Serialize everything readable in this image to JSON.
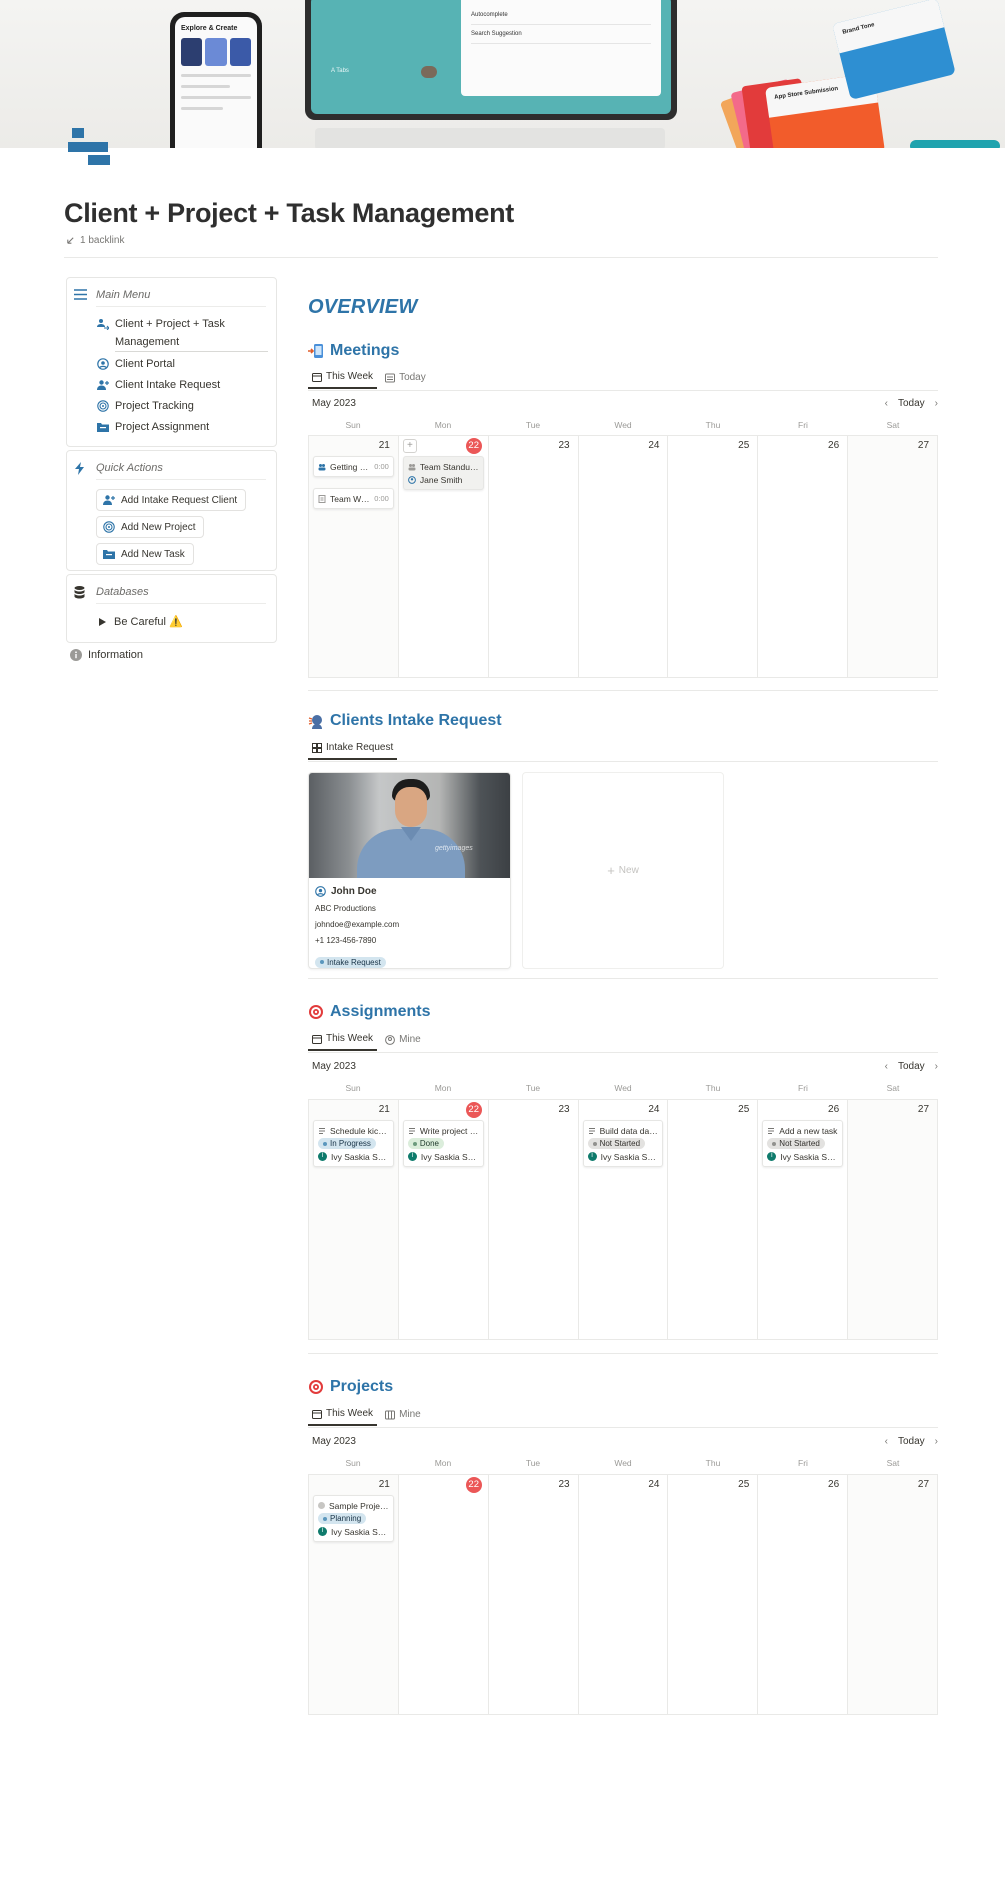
{
  "cover": {
    "phone_title": "Explore & Create",
    "panel_items": [
      "Autocomplete",
      "Search Suggestion"
    ],
    "tablet_label": "A Tabs",
    "card_blue": "Brand Tone",
    "card_orange": "App Store Submission"
  },
  "page": {
    "title": "Client + Project + Task Management",
    "backlink": "1 backlink"
  },
  "sidebar": {
    "main_menu": {
      "heading": "Main Menu",
      "items": [
        {
          "label": "Client + Project + Task Management",
          "icon": "people-arrow-icon"
        },
        {
          "label": "Client Portal",
          "icon": "user-circle-icon"
        },
        {
          "label": "Client Intake Request",
          "icon": "user-plus-icon"
        },
        {
          "label": "Project Tracking",
          "icon": "target-icon"
        },
        {
          "label": "Project Assignment",
          "icon": "folder-icon"
        }
      ]
    },
    "quick_actions": {
      "heading": "Quick Actions",
      "buttons": [
        {
          "label": "Add Intake Request Client",
          "icon": "user-plus-icon"
        },
        {
          "label": "Add New Project",
          "icon": "target-icon"
        },
        {
          "label": "Add New Task",
          "icon": "folder-icon"
        }
      ]
    },
    "databases": {
      "heading": "Databases",
      "toggle_label": "Be Careful ⚠️"
    },
    "information": "Information"
  },
  "main": {
    "overview": "OVERVIEW",
    "days_of_week": [
      "Sun",
      "Mon",
      "Tue",
      "Wed",
      "Thu",
      "Fri",
      "Sat"
    ],
    "dates": [
      "21",
      "22",
      "23",
      "24",
      "25",
      "26",
      "27"
    ],
    "month": "May 2023",
    "today_label": "Today",
    "meetings": {
      "title": "Meetings",
      "tabs": [
        "This Week",
        "Today"
      ],
      "events": [
        {
          "title": "Getting star…",
          "time": "0:00"
        },
        {
          "title": "Team Week…",
          "time": "0:00"
        },
        {
          "title": "Team Standup …",
          "person": "Jane Smith"
        }
      ]
    },
    "clients": {
      "title": "Clients Intake Request",
      "tabs": [
        "Intake Request"
      ],
      "card": {
        "name": "John Doe",
        "company": "ABC Productions",
        "email": "johndoe@example.com",
        "phone": "+1 123-456-7890",
        "tag": "Intake Request",
        "watermark": "gettyimages"
      },
      "new_label": "New"
    },
    "assignments": {
      "title": "Assignments",
      "tabs": [
        "This Week",
        "Mine"
      ],
      "events": [
        {
          "title": "Schedule kick-o…",
          "status": "In Progress",
          "person": "Ivy Saskia Sejas Rod"
        },
        {
          "title": "Write project pr…",
          "status": "Done",
          "person": "Ivy Saskia Sejas Rod"
        },
        {
          "title": "Build data dash…",
          "status": "Not Started",
          "person": "Ivy Saskia Sejas Rod"
        },
        {
          "title": "Add a new task",
          "status": "Not Started",
          "person": "Ivy Saskia Sejas Rod"
        }
      ]
    },
    "projects": {
      "title": "Projects",
      "tabs": [
        "This Week",
        "Mine"
      ],
      "events": [
        {
          "title": "Sample Project: …",
          "status": "Planning",
          "person": "Ivy Saskia Sejas Rod"
        }
      ]
    }
  },
  "colors": {
    "accent": "#2e74a8",
    "today": "#eb5757",
    "in_progress_bg": "#d3e5ef",
    "done_bg": "#dbeddb",
    "not_started_bg": "#e3e2e0",
    "avatar": "#0f7b6c"
  }
}
